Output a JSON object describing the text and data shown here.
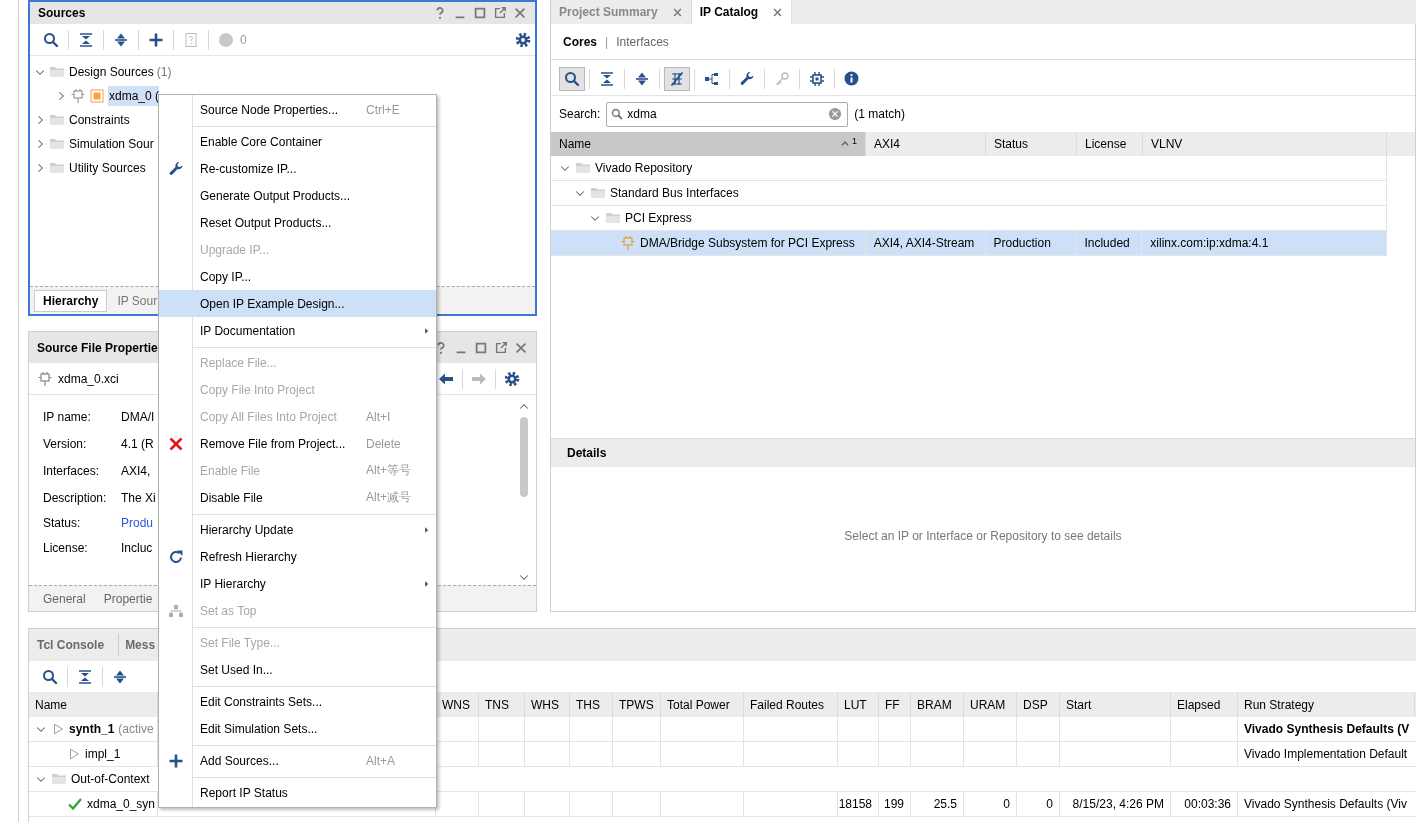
{
  "sources": {
    "title": "Sources",
    "issue_count": "0",
    "tree": [
      {
        "label": "Design Sources",
        "count": "(1)",
        "kind": "folder",
        "expanded": true,
        "selected": false,
        "children": [
          {
            "label": "xdma_0 (",
            "kind": "ip",
            "expanded": false,
            "selected": true
          }
        ]
      },
      {
        "label": "Constraints",
        "kind": "folder",
        "expanded": false,
        "selected": false
      },
      {
        "label": "Simulation Sour",
        "kind": "folder",
        "expanded": false,
        "selected": false
      },
      {
        "label": "Utility Sources",
        "kind": "folder",
        "expanded": false,
        "selected": false
      }
    ],
    "tabs": [
      {
        "label": "Hierarchy",
        "selected": true
      },
      {
        "label": "IP Sour",
        "selected": false
      }
    ]
  },
  "properties": {
    "title": "Source File Propertie",
    "file": "xdma_0.xci",
    "fields": [
      {
        "label": "IP name:",
        "value": "DMA/I",
        "kind": "text"
      },
      {
        "label": "Version:",
        "value": "4.1 (R",
        "kind": "text"
      },
      {
        "label": "Interfaces:",
        "value": "AXI4,",
        "kind": "text"
      },
      {
        "label": "Description:",
        "value": "The Xi",
        "kind": "text"
      },
      {
        "label": "Status:",
        "value": "Produ",
        "kind": "link"
      },
      {
        "label": "License:",
        "value": "Incluc",
        "kind": "text"
      }
    ],
    "tabs": [
      "General",
      "Propertie"
    ]
  },
  "editor_tabs": [
    {
      "label": "Project Summary",
      "selected": false
    },
    {
      "label": "IP Catalog",
      "selected": true
    }
  ],
  "ip_catalog": {
    "views": [
      {
        "label": "Cores",
        "selected": true
      },
      {
        "label": "Interfaces",
        "selected": false
      }
    ],
    "view_separator": "|",
    "toolbar": [
      {
        "kind": "search",
        "on": true,
        "disabled": false
      },
      {
        "kind": "collapse",
        "on": false,
        "disabled": false
      },
      {
        "kind": "expand",
        "on": false,
        "disabled": false
      },
      {
        "kind": "filter",
        "on": true,
        "disabled": false
      },
      {
        "kind": "hierarchy",
        "on": false,
        "disabled": false
      },
      {
        "kind": "wrench",
        "on": false,
        "disabled": false
      },
      {
        "kind": "key",
        "on": false,
        "disabled": true
      },
      {
        "kind": "chip",
        "on": false,
        "disabled": false
      },
      {
        "kind": "info",
        "on": false,
        "disabled": false
      }
    ],
    "search": {
      "label": "Search:",
      "value": "xdma"
    },
    "match_count": "(1 match)",
    "columns": [
      {
        "label": "Name",
        "sorted": true,
        "sort_rank": "1"
      },
      {
        "label": "AXI4",
        "sorted": false
      },
      {
        "label": "Status",
        "sorted": false
      },
      {
        "label": "License",
        "sorted": false
      },
      {
        "label": "VLNV",
        "sorted": false
      }
    ],
    "tree": [
      {
        "label": "Vivado Repository",
        "expanded": true,
        "selected": false,
        "children": [
          {
            "label": "Standard Bus Interfaces",
            "expanded": true,
            "selected": false,
            "children": [
              {
                "label": "PCI Express",
                "expanded": true,
                "selected": false,
                "children": [
                  {
                    "label": "DMA/Bridge Subsystem for PCI Express",
                    "selected": true,
                    "cells": [
                      "AXI4, AXI4-Stream",
                      "Production",
                      "Included",
                      "xilinx.com:ip:xdma:4.1"
                    ]
                  }
                ]
              }
            ]
          }
        ]
      }
    ],
    "details": {
      "title": "Details",
      "hint": "Select an IP or Interface or Repository to see details"
    }
  },
  "console": {
    "tabs": [
      "Tcl Console",
      "Mess"
    ],
    "columns": [
      "Name",
      "WNS",
      "TNS",
      "WHS",
      "THS",
      "TPWS",
      "Total Power",
      "Failed Routes",
      "LUT",
      "FF",
      "BRAM",
      "URAM",
      "DSP",
      "Start",
      "Elapsed",
      "Run Strategy"
    ],
    "rows": [
      {
        "kind": "run",
        "name": "synth_1",
        "note": "(active",
        "active": true,
        "expanded": true,
        "cells": [
          null,
          null,
          null,
          null,
          null,
          null,
          null,
          null,
          null,
          null,
          null,
          null,
          null,
          null,
          "Vivado Synthesis Defaults (V"
        ],
        "children": [
          {
            "kind": "run",
            "name": "impl_1",
            "active": false,
            "cells": [
              null,
              null,
              null,
              null,
              null,
              null,
              null,
              null,
              null,
              null,
              null,
              null,
              null,
              null,
              "Vivado Implementation Default"
            ]
          }
        ]
      },
      {
        "kind": "group",
        "name": "Out-of-Context",
        "active": false,
        "expanded": true,
        "children": [
          {
            "kind": "done",
            "name": "xdma_0_syn",
            "active": false,
            "cells": [
              null,
              null,
              null,
              null,
              null,
              null,
              null,
              "18158",
              "199",
              "25.5",
              "0",
              "0",
              "8/15/23, 4:26 PM",
              "00:03:36",
              "Vivado Synthesis Defaults (Viv"
            ]
          }
        ]
      }
    ]
  },
  "menu": {
    "groups": [
      [
        {
          "label": "Source Node Properties...",
          "shortcut": "Ctrl+E",
          "disabled": false,
          "selected": false,
          "submenu": false
        }
      ],
      [
        {
          "label": "Enable Core Container",
          "disabled": false,
          "selected": false,
          "submenu": false
        },
        {
          "label": "Re-customize IP...",
          "disabled": false,
          "selected": false,
          "submenu": false
        },
        {
          "label": "Generate Output Products...",
          "disabled": false,
          "selected": false,
          "submenu": false
        },
        {
          "label": "Reset Output Products...",
          "disabled": false,
          "selected": false,
          "submenu": false
        },
        {
          "label": "Upgrade IP...",
          "disabled": true,
          "selected": false,
          "submenu": false
        },
        {
          "label": "Copy IP...",
          "disabled": false,
          "selected": false,
          "submenu": false
        },
        {
          "label": "Open IP Example Design...",
          "disabled": false,
          "selected": true,
          "submenu": false
        },
        {
          "label": "IP Documentation",
          "disabled": false,
          "selected": false,
          "submenu": true
        }
      ],
      [
        {
          "label": "Replace File...",
          "disabled": true,
          "selected": false,
          "submenu": false
        },
        {
          "label": "Copy File Into Project",
          "disabled": true,
          "selected": false,
          "submenu": false
        },
        {
          "label": "Copy All Files Into Project",
          "shortcut": "Alt+I",
          "disabled": true,
          "selected": false,
          "submenu": false
        },
        {
          "label": "Remove File from Project...",
          "shortcut": "Delete",
          "disabled": false,
          "selected": false,
          "submenu": false
        },
        {
          "label": "Enable File",
          "shortcut": "Alt+等号",
          "disabled": true,
          "selected": false,
          "submenu": false
        },
        {
          "label": "Disable File",
          "shortcut": "Alt+减号",
          "disabled": false,
          "selected": false,
          "submenu": false
        }
      ],
      [
        {
          "label": "Hierarchy Update",
          "disabled": false,
          "selected": false,
          "submenu": true
        },
        {
          "label": "Refresh Hierarchy",
          "disabled": false,
          "selected": false,
          "submenu": false
        },
        {
          "label": "IP Hierarchy",
          "disabled": false,
          "selected": false,
          "submenu": true
        },
        {
          "label": "Set as Top",
          "disabled": true,
          "selected": false,
          "submenu": false
        }
      ],
      [
        {
          "label": "Set File Type...",
          "disabled": true,
          "selected": false,
          "submenu": false
        },
        {
          "label": "Set Used In...",
          "disabled": false,
          "selected": false,
          "submenu": false
        }
      ],
      [
        {
          "label": "Edit Constraints Sets...",
          "disabled": false,
          "selected": false,
          "submenu": false
        },
        {
          "label": "Edit Simulation Sets...",
          "disabled": false,
          "selected": false,
          "submenu": false
        }
      ],
      [
        {
          "label": "Add Sources...",
          "shortcut": "Alt+A",
          "disabled": false,
          "selected": false,
          "submenu": false
        }
      ],
      [
        {
          "label": "Report IP Status",
          "disabled": false,
          "selected": false,
          "submenu": false
        }
      ]
    ]
  }
}
